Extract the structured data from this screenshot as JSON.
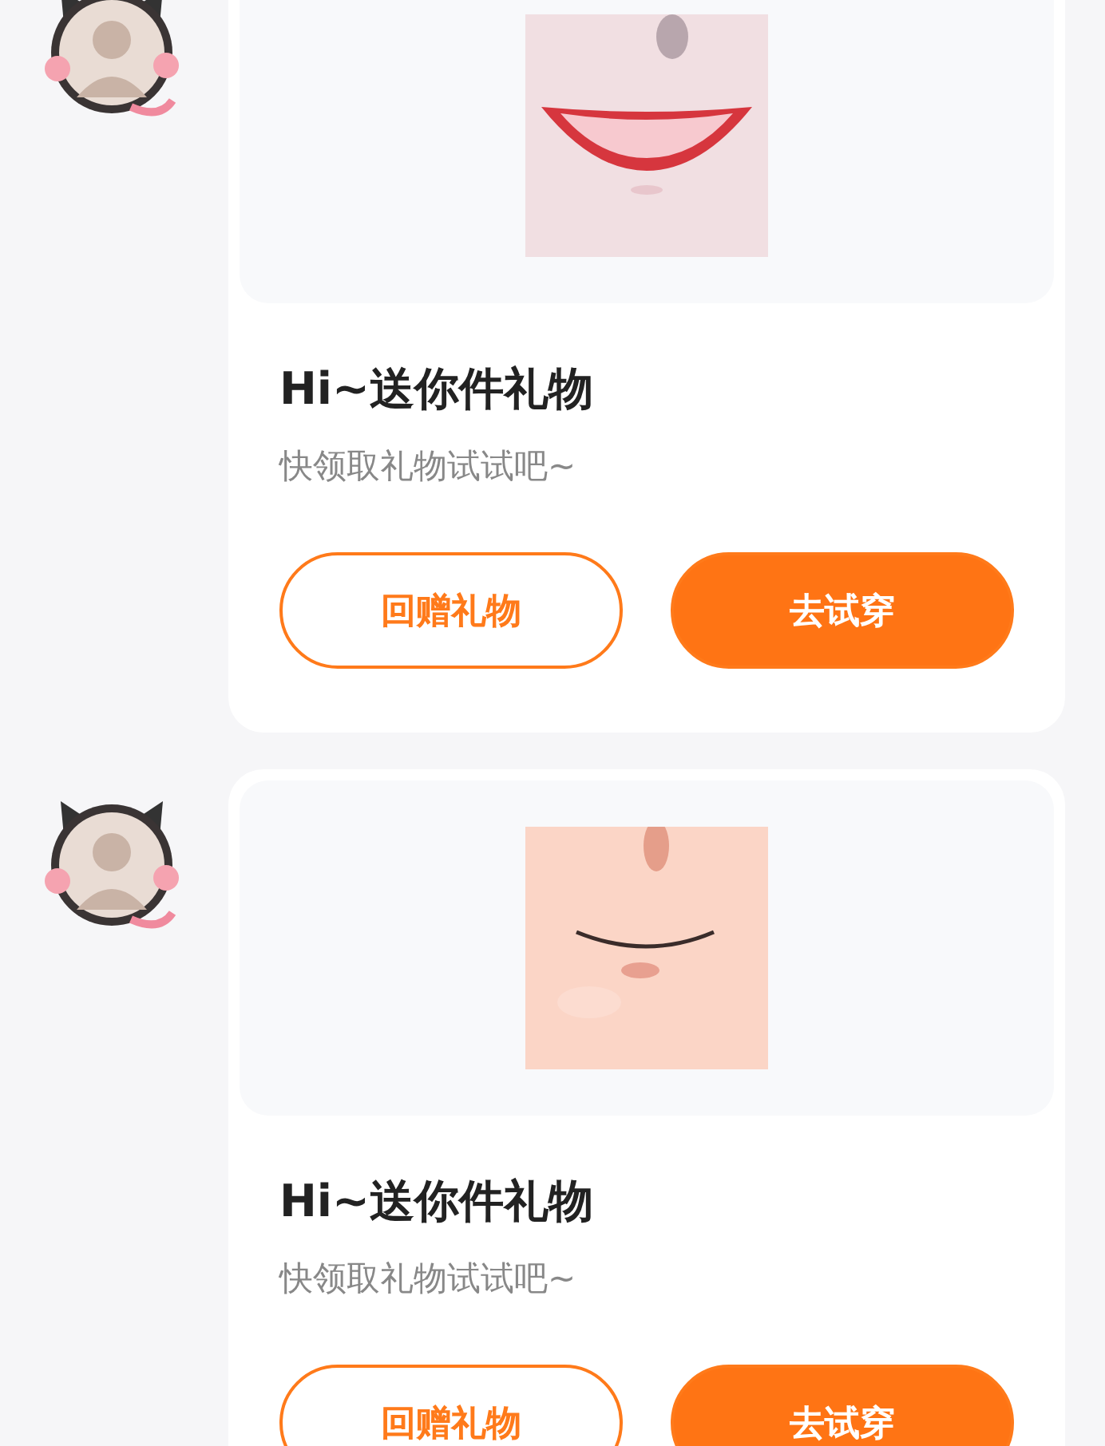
{
  "messages": [
    {
      "sender": {
        "kind": "avatar"
      },
      "gift": {
        "title": "Hi~送你件礼物",
        "subtitle": "快领取礼物试试吧~",
        "buttons": [
          {
            "label": "回赠礼物",
            "kind": "outline"
          },
          {
            "label": "去试穿",
            "kind": "filled"
          }
        ]
      }
    },
    {
      "sender": {
        "kind": "avatar"
      },
      "gift": {
        "title": "Hi~送你件礼物",
        "subtitle": "快领取礼物试试吧~",
        "buttons": [
          {
            "label": "回赠礼物",
            "kind": "outline"
          },
          {
            "label": "去试穿",
            "kind": "filled"
          }
        ]
      }
    }
  ]
}
